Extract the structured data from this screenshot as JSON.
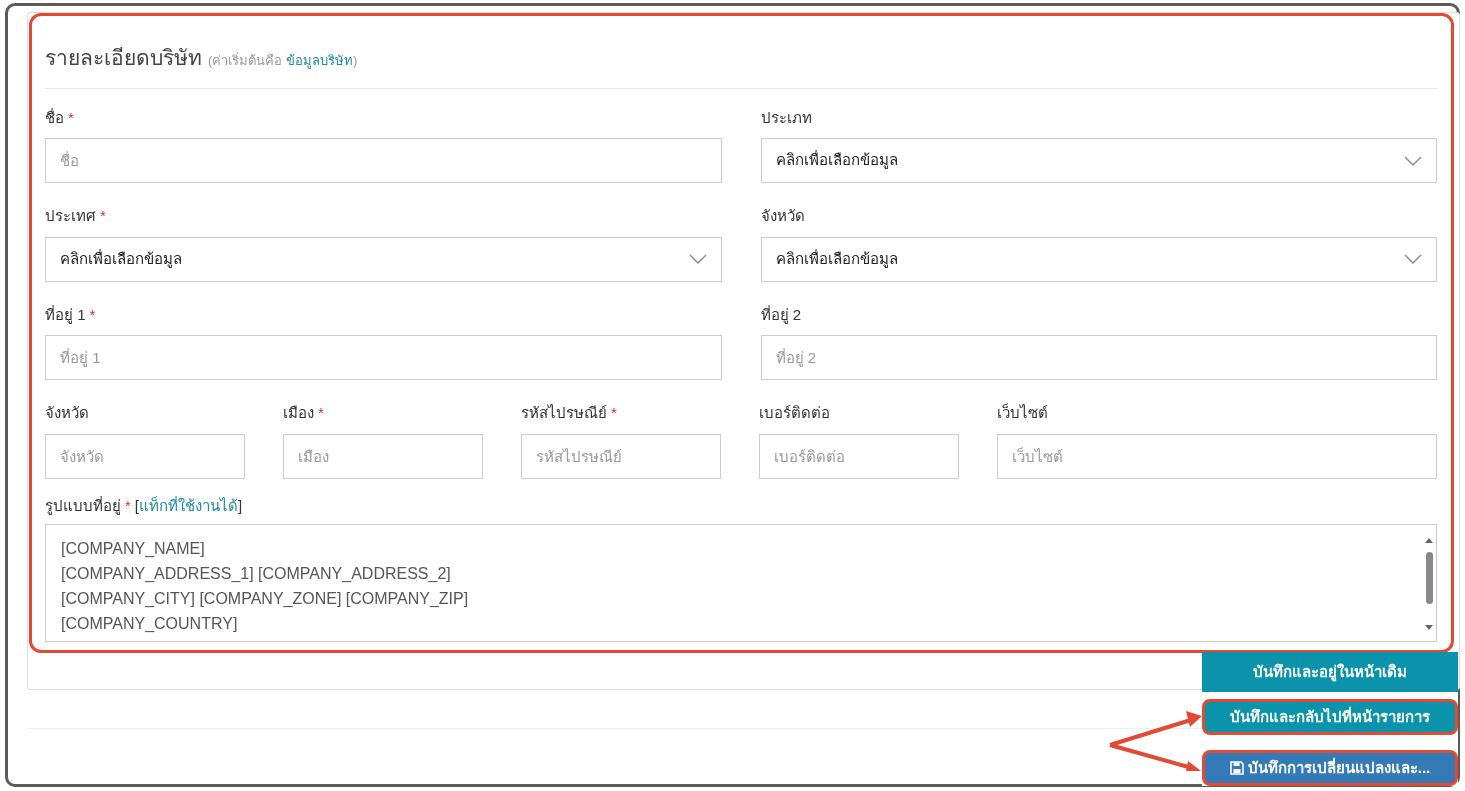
{
  "heading": {
    "title": "รายละเอียดบริษัท",
    "note_before": "(ค่าเริ่มต้นคือ",
    "note_link": "ข้อมูลบริษัท",
    "note_after": ")"
  },
  "required_mark": "*",
  "rows": [
    {
      "kind": "half",
      "fields": [
        {
          "label": "ชื่อ",
          "required": true,
          "kind": "text",
          "placeholder": "ชื่อ"
        },
        {
          "label": "ประเภท",
          "required": false,
          "kind": "select",
          "value": "คลิกเพื่อเลือกข้อมูล"
        }
      ]
    },
    {
      "kind": "half",
      "fields": [
        {
          "label": "ประเทศ",
          "required": true,
          "kind": "select",
          "value": "คลิกเพื่อเลือกข้อมูล"
        },
        {
          "label": "จังหวัด",
          "required": false,
          "kind": "select",
          "value": "คลิกเพื่อเลือกข้อมูล"
        }
      ]
    },
    {
      "kind": "half",
      "fields": [
        {
          "label": "ที่อยู่ 1",
          "required": true,
          "kind": "text",
          "placeholder": "ที่อยู่ 1"
        },
        {
          "label": "ที่อยู่ 2",
          "required": false,
          "kind": "text",
          "placeholder": "ที่อยู่ 2"
        }
      ]
    },
    {
      "kind": "five",
      "fields": [
        {
          "label": "จังหวัด",
          "required": false,
          "kind": "text",
          "placeholder": "จังหวัด"
        },
        {
          "label": "เมือง",
          "required": true,
          "kind": "text",
          "placeholder": "เมือง"
        },
        {
          "label": "รหัสไปรษณีย์",
          "required": true,
          "kind": "text",
          "placeholder": "รหัสไปรษณีย์"
        },
        {
          "label": "เบอร์ติดต่อ",
          "required": false,
          "kind": "text",
          "placeholder": "เบอร์ติดต่อ"
        },
        {
          "label": "เว็บไซต์",
          "required": false,
          "kind": "text",
          "placeholder": "เว็บไซต์"
        }
      ]
    }
  ],
  "address_format": {
    "label": "รูปแบบที่อยู่",
    "required": true,
    "bracket_open": "[",
    "link": "แท็กที่ใช้งานได้",
    "bracket_close": "]",
    "lines": [
      "[COMPANY_NAME]",
      "[COMPANY_ADDRESS_1] [COMPANY_ADDRESS_2]",
      "[COMPANY_CITY] [COMPANY_ZONE] [COMPANY_ZIP]",
      "[COMPANY_COUNTRY]"
    ]
  },
  "actions": [
    {
      "label": "บันทึกและอยู่ในหน้าเดิม",
      "kind": "teal",
      "highlighted": false
    },
    {
      "label": "บันทึกและกลับไปที่หน้ารายการ",
      "kind": "teal",
      "highlighted": true
    },
    {
      "label": "บันทึกการเปลี่ยนแปลงและ...",
      "kind": "primary",
      "highlighted": true
    }
  ]
}
